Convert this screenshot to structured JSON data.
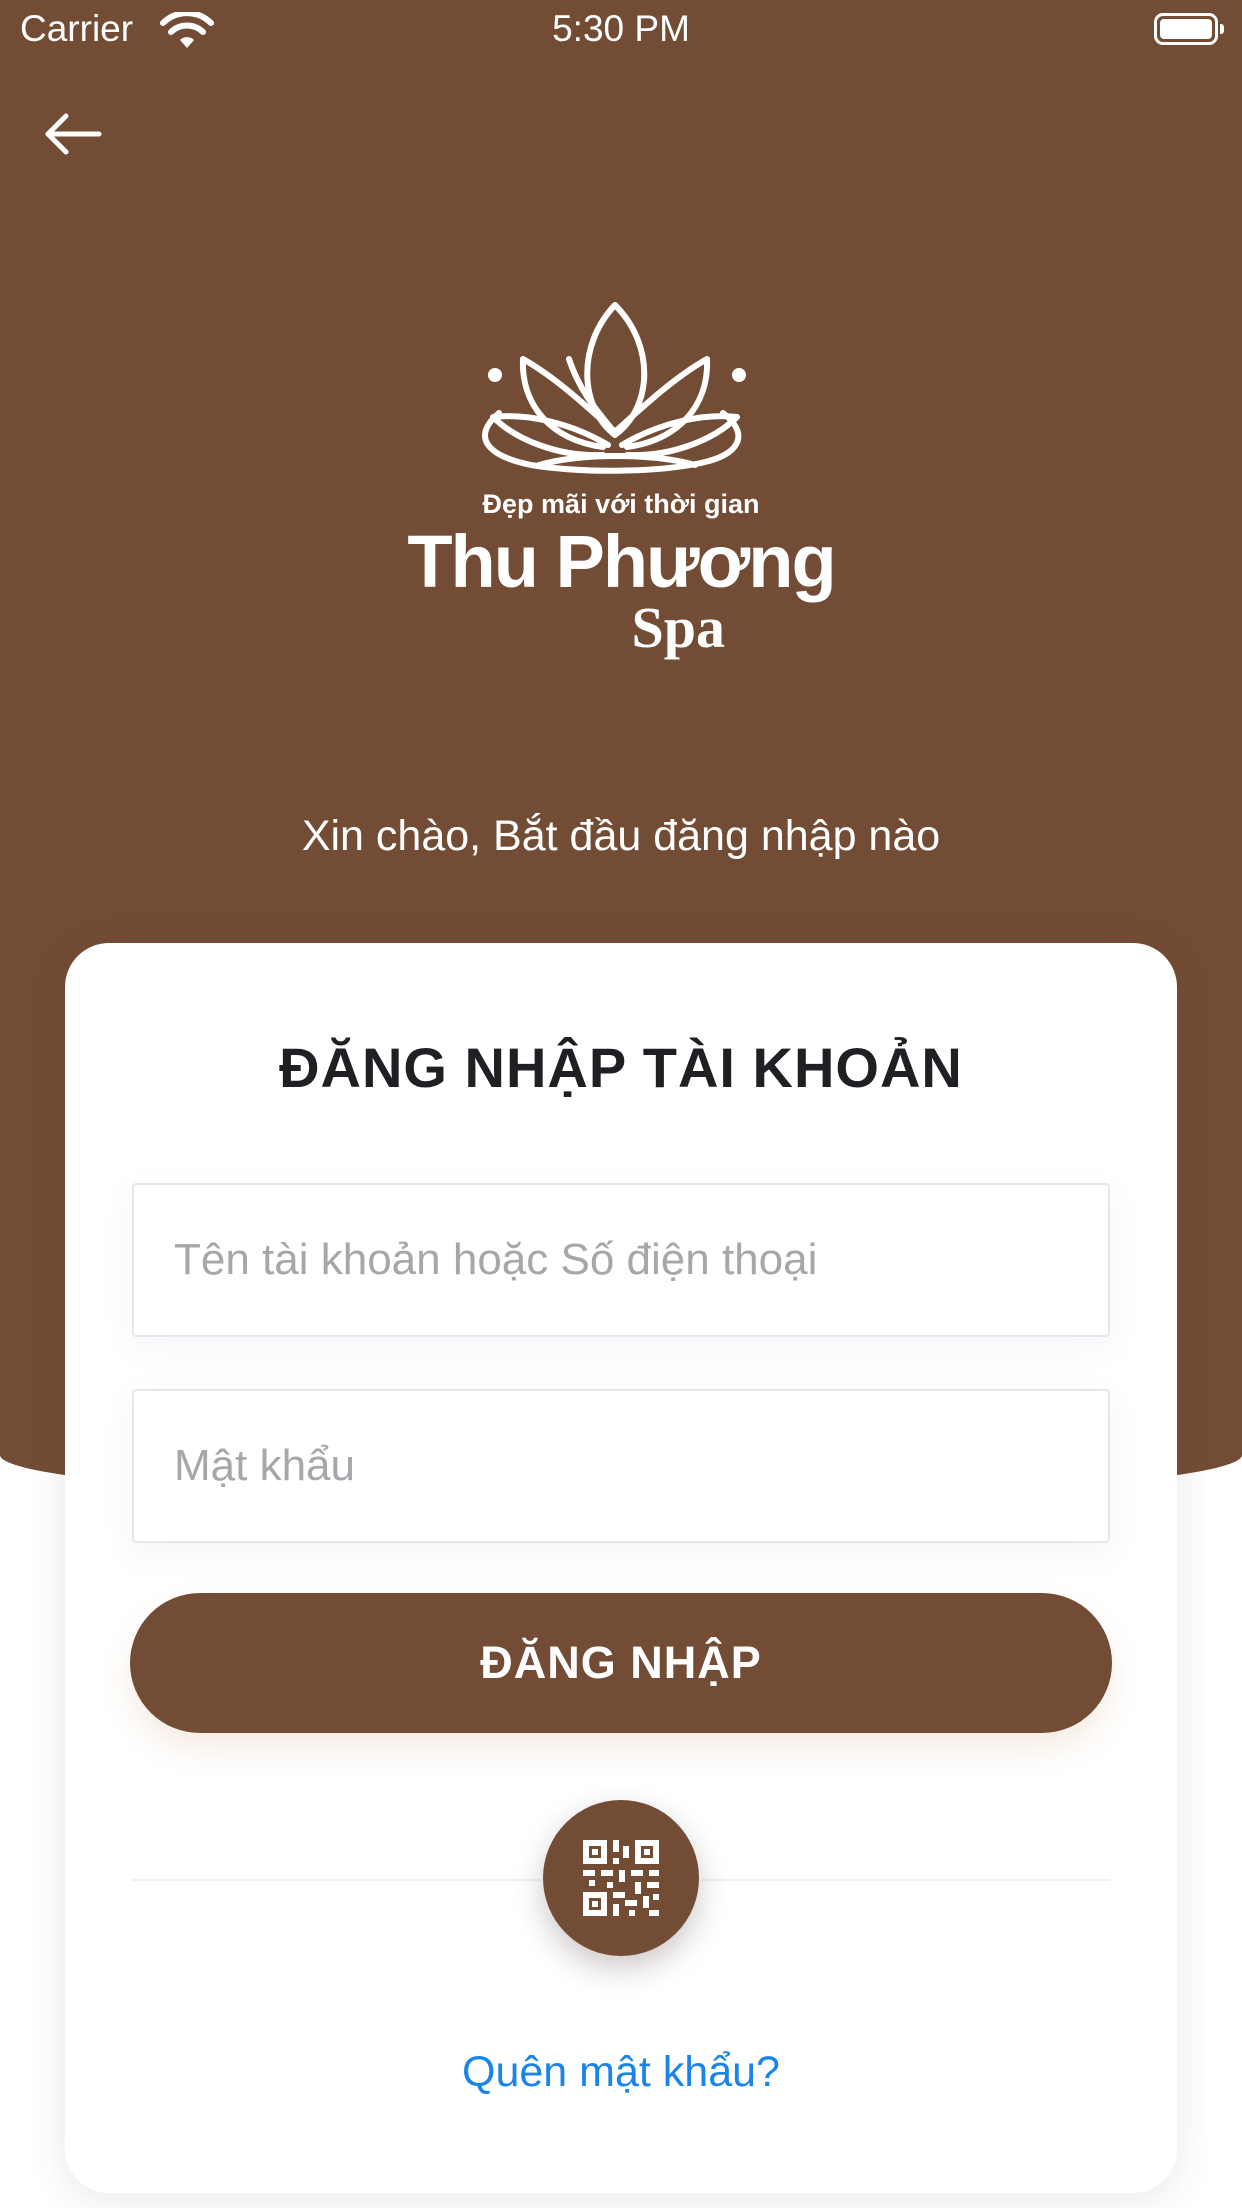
{
  "status_bar": {
    "carrier": "Carrier",
    "time": "5:30 PM"
  },
  "brand": {
    "tagline": "Đẹp mãi với thời gian",
    "name": "Thu Phương",
    "suffix": "Spa"
  },
  "greeting": "Xin chào, Bắt đầu đăng nhập nào",
  "login_card": {
    "title": "ĐĂNG NHẬP TÀI KHOẢN",
    "username_placeholder": "Tên tài khoản hoặc Số điện thoại",
    "password_placeholder": "Mật khẩu",
    "login_button": "ĐĂNG NHẬP",
    "forgot_password": "Quên mật khẩu?"
  },
  "icons": {
    "back": "arrow-left-icon",
    "qr": "qr-code-icon",
    "wifi": "wifi-icon",
    "battery": "battery-icon"
  },
  "colors": {
    "brand_brown": "#734c35",
    "link_blue": "#1a84ea",
    "title_dark": "#1f1f24",
    "placeholder_gray": "#a7a7ab"
  }
}
